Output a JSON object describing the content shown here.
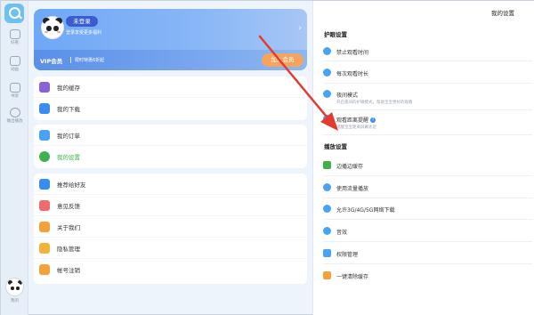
{
  "rail": {
    "items": [
      {
        "label": "好看",
        "icon": "cat-icon"
      },
      {
        "label": "动画",
        "icon": "tv-icon"
      },
      {
        "label": "书架",
        "icon": "book-icon"
      },
      {
        "label": "做出播放",
        "icon": "clock-icon"
      }
    ],
    "avatar_label": "我的"
  },
  "profile": {
    "status": "未登录",
    "subtitle": "登录享受更多福利",
    "vip_title": "VIP会员",
    "vip_subtitle": "限时特惠6折起",
    "vip_button": "加入会员"
  },
  "menu_group_1": [
    {
      "label": "我的缓存",
      "color": "#8a63d2",
      "icon": "cache-icon"
    },
    {
      "label": "我的下载",
      "color": "#3a8df0",
      "icon": "download-icon"
    }
  ],
  "menu_group_2": [
    {
      "label": "我的订单",
      "color": "#4aa3f2",
      "icon": "order-icon"
    },
    {
      "label": "我的设置",
      "color": "#3fb04b",
      "icon": "gear-icon",
      "active": true
    }
  ],
  "menu_group_3": [
    {
      "label": "推荐给好友",
      "color": "#3a8df0",
      "icon": "thumb-icon"
    },
    {
      "label": "意见反馈",
      "color": "#f06b6b",
      "icon": "feedback-icon"
    },
    {
      "label": "关于我们",
      "color": "#f3a23a",
      "icon": "about-icon"
    },
    {
      "label": "隐私管理",
      "color": "#f3b23a",
      "icon": "privacy-icon"
    },
    {
      "label": "帐号注销",
      "color": "#f3a23a",
      "icon": "account-icon"
    }
  ],
  "settings": {
    "title": "我的设置",
    "eye_section": "护眼设置",
    "eye_items": [
      {
        "label": "禁止观看时间",
        "sub": "",
        "color": "#4aa3f2"
      },
      {
        "label": "每次观看时长",
        "sub": "",
        "color": "#4aa3f2"
      },
      {
        "label": "夜间模式",
        "sub": "开启夜间的护眼模式，帮助宝宝更好的观看",
        "color": "#4aa3f2"
      },
      {
        "label": "观看距离提醒",
        "sub": "提醒宝宝距离屏幕太近",
        "color": "#4aa3f2",
        "help": "?"
      }
    ],
    "play_section": "播放设置",
    "play_items": [
      {
        "label": "边播边缓存",
        "color": "#3fb04b"
      },
      {
        "label": "使用流量播放",
        "color": "#4aa3f2"
      },
      {
        "label": "允许3G/4G/5G网络下载",
        "color": "#4aa3f2"
      },
      {
        "label": "音效",
        "color": "#4aa3f2"
      },
      {
        "label": "权限管理",
        "color": "#4aa3f2"
      },
      {
        "label": "一键清除缓存",
        "color": "#f3a23a"
      }
    ]
  },
  "annotation_color": "#e23b32"
}
